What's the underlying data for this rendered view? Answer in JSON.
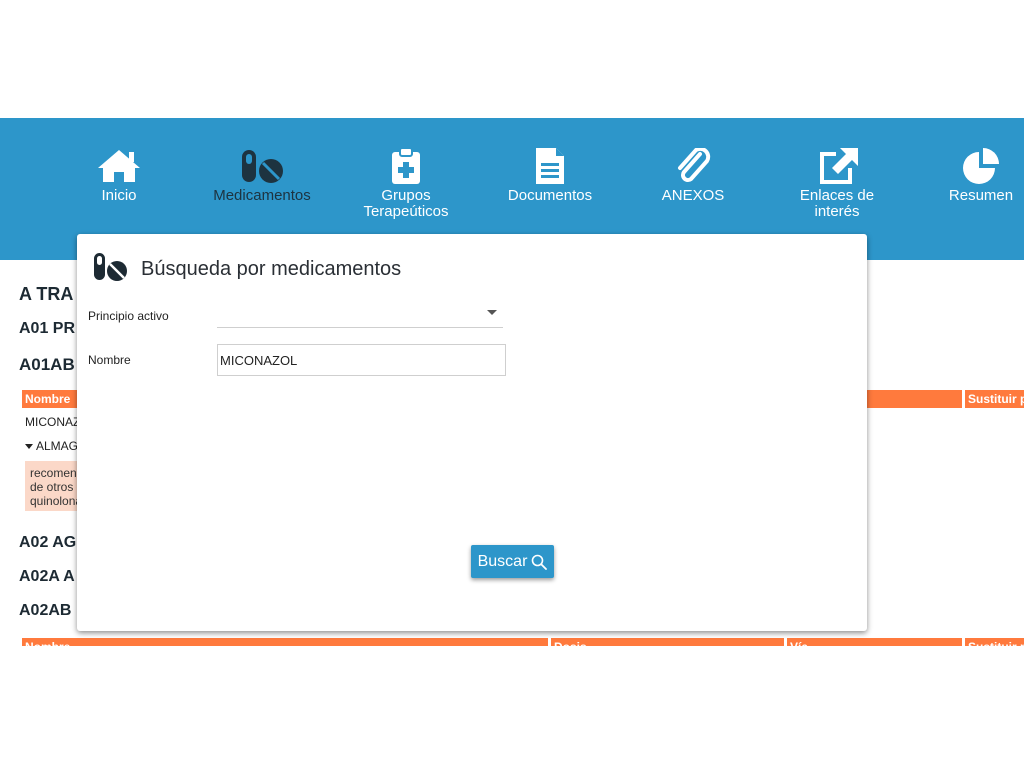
{
  "nav": {
    "items": [
      {
        "label": "Inicio",
        "icon": "home-icon"
      },
      {
        "label": "Medicamentos",
        "icon": "pills-icon"
      },
      {
        "label": "Grupos\nTerapeúticos",
        "icon": "clipboard-plus-icon"
      },
      {
        "label": "Documentos",
        "icon": "document-icon"
      },
      {
        "label": "ANEXOS",
        "icon": "paperclip-icon"
      },
      {
        "label": "Enlaces de\ninterés",
        "icon": "external-link-icon"
      },
      {
        "label": "Resumen",
        "icon": "pie-chart-icon"
      }
    ],
    "background": "#2d96ca"
  },
  "background_content": {
    "h1": "A TRA",
    "h2": "A01 PR",
    "h3": "A01AB",
    "table1_header_nombre": "Nombre",
    "table1_header_sustituir": "Sustituir p",
    "row_miconazol": "MICONAZ",
    "row_almacen": "ALMAG",
    "warning_lines": [
      "recomend",
      "de otros",
      "quinolona"
    ],
    "h4": "A02 AG",
    "h5": "A02A A",
    "h6": "A02AB",
    "table2_header_nombre": "Nombre",
    "table2_header_dosis": "Dosis",
    "table2_header_via": "Vía",
    "table2_header_sustituir": "Sustituir p"
  },
  "modal": {
    "title": "Búsqueda por medicamentos",
    "principio_label": "Principio activo",
    "principio_value": "",
    "nombre_label": "Nombre",
    "nombre_value": "MICONAZOL",
    "buscar_label": "Buscar"
  },
  "colors": {
    "accent": "#2d96ca",
    "orange": "#ff7a3d",
    "warning_bg": "#fbd8c8"
  }
}
